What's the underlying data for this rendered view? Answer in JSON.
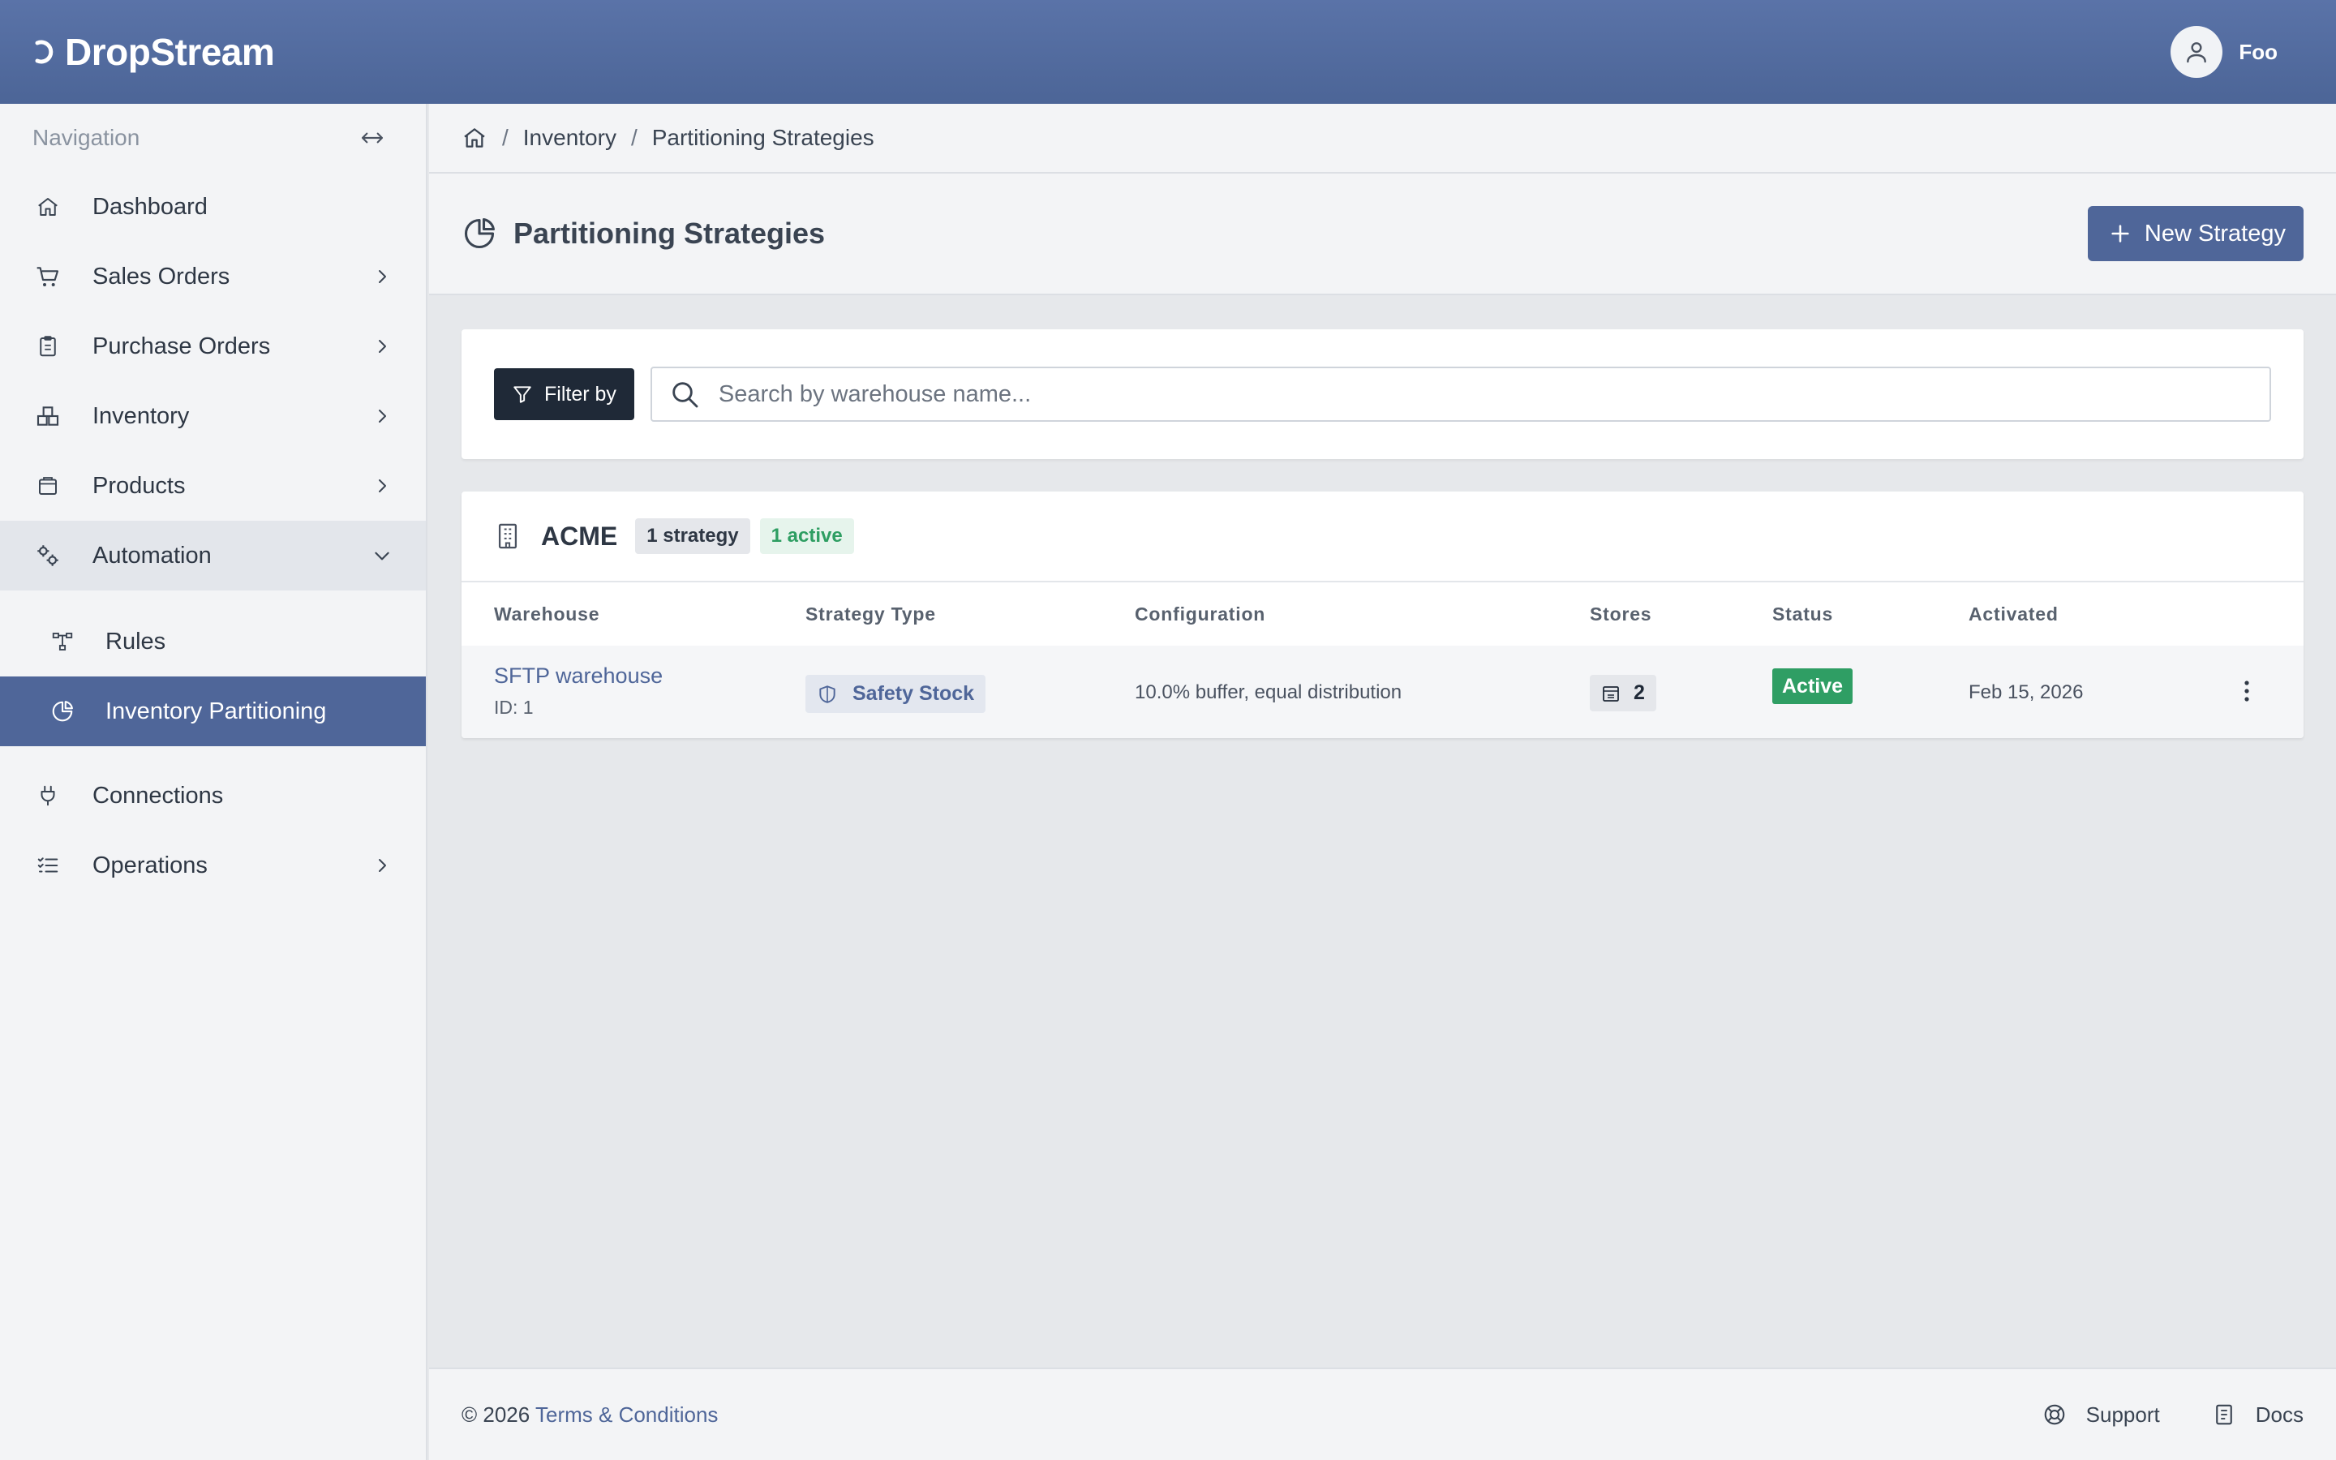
{
  "app": {
    "brand": "DropStream",
    "user_name": "Foo"
  },
  "sidebar": {
    "header": "Navigation",
    "items": [
      {
        "label": "Dashboard",
        "icon": "home-icon",
        "has_chevron": false
      },
      {
        "label": "Sales Orders",
        "icon": "cart-icon",
        "has_chevron": true
      },
      {
        "label": "Purchase Orders",
        "icon": "clipboard-icon",
        "has_chevron": true
      },
      {
        "label": "Inventory",
        "icon": "boxes-icon",
        "has_chevron": true
      },
      {
        "label": "Products",
        "icon": "package-icon",
        "has_chevron": true
      },
      {
        "label": "Automation",
        "icon": "cogs-icon",
        "has_chevron": true,
        "expanded": true
      },
      {
        "label": "Connections",
        "icon": "plug-icon",
        "has_chevron": false
      },
      {
        "label": "Operations",
        "icon": "list-icon",
        "has_chevron": true
      }
    ],
    "sub_items": [
      {
        "label": "Rules",
        "icon": "workflow-icon",
        "active": false
      },
      {
        "label": "Inventory Partitioning",
        "icon": "pie-chart-icon",
        "active": true
      }
    ]
  },
  "breadcrumb": {
    "items": [
      "Inventory",
      "Partitioning Strategies"
    ]
  },
  "page": {
    "title": "Partitioning Strategies",
    "new_button": "New Strategy"
  },
  "filter": {
    "button": "Filter by",
    "search_placeholder": "Search by warehouse name..."
  },
  "group": {
    "name": "ACME",
    "strategy_count": "1 strategy",
    "active_count": "1 active"
  },
  "table": {
    "columns": [
      "Warehouse",
      "Strategy Type",
      "Configuration",
      "Stores",
      "Status",
      "Activated"
    ],
    "rows": [
      {
        "warehouse": "SFTP warehouse",
        "id": "ID: 1",
        "strategy_type": "Safety Stock",
        "configuration": "10.0% buffer, equal distribution",
        "stores": "2",
        "status": "Active",
        "activated": "Feb 15, 2026"
      }
    ]
  },
  "footer": {
    "copyright": "© 2026",
    "terms": "Terms & Conditions",
    "support": "Support",
    "docs": "Docs"
  },
  "colors": {
    "topbar": "#4f6699",
    "accent": "#4f6699",
    "active_status": "#2f9e64",
    "dark_button": "#1f2937"
  }
}
